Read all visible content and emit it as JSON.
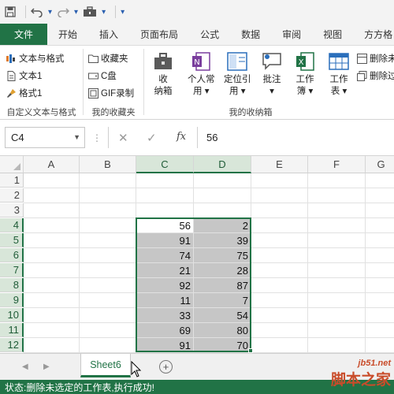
{
  "qat": {
    "save_icon": "save-icon",
    "undo_icon": "undo-icon",
    "redo_icon": "redo-icon",
    "tool_icon": "toolbox-icon"
  },
  "tabs": [
    "文件",
    "开始",
    "插入",
    "页面布局",
    "公式",
    "数据",
    "审阅",
    "视图",
    "方方格"
  ],
  "ribbon": {
    "group1": {
      "items": [
        "文本与格式",
        "文本1",
        "格式1"
      ],
      "label": "自定义文本与格式"
    },
    "group2": {
      "items": [
        "收藏夹",
        "C盘",
        "GIF录制"
      ],
      "label": "我的收藏夹"
    },
    "group3": {
      "label": "我的收纳箱",
      "big": [
        {
          "line1": "收",
          "line2": "纳箱"
        },
        {
          "line1": "个人常",
          "line2": "用 ▾"
        },
        {
          "line1": "定位引",
          "line2": "用 ▾"
        },
        {
          "line1": "批注",
          "line2": "▾"
        },
        {
          "line1": "工作",
          "line2": "簿 ▾"
        },
        {
          "line1": "工作",
          "line2": "表 ▾"
        }
      ],
      "small": [
        "删除未",
        "删除过"
      ]
    }
  },
  "formula_bar": {
    "name_box": "C4",
    "cancel": "✕",
    "enter": "✓",
    "fx": "fx",
    "value": "56"
  },
  "grid": {
    "columns": [
      "A",
      "B",
      "C",
      "D",
      "E",
      "F",
      "G"
    ],
    "rows": [
      "1",
      "2",
      "3",
      "4",
      "5",
      "6",
      "7",
      "8",
      "9",
      "10",
      "11",
      "12"
    ],
    "data_c": [
      "56",
      "91",
      "74",
      "21",
      "92",
      "11",
      "33",
      "69",
      "91"
    ],
    "data_d": [
      "2",
      "39",
      "75",
      "28",
      "87",
      "7",
      "54",
      "80",
      "70"
    ]
  },
  "sheets": {
    "active": "Sheet6",
    "add": "+"
  },
  "status": {
    "text": "状态:删除未选定的工作表,执行成功!"
  },
  "watermark": {
    "site": "jb51.net",
    "brand": "脚本之家"
  },
  "colors": {
    "accent": "#217346",
    "selection": "#c6c6c6"
  }
}
